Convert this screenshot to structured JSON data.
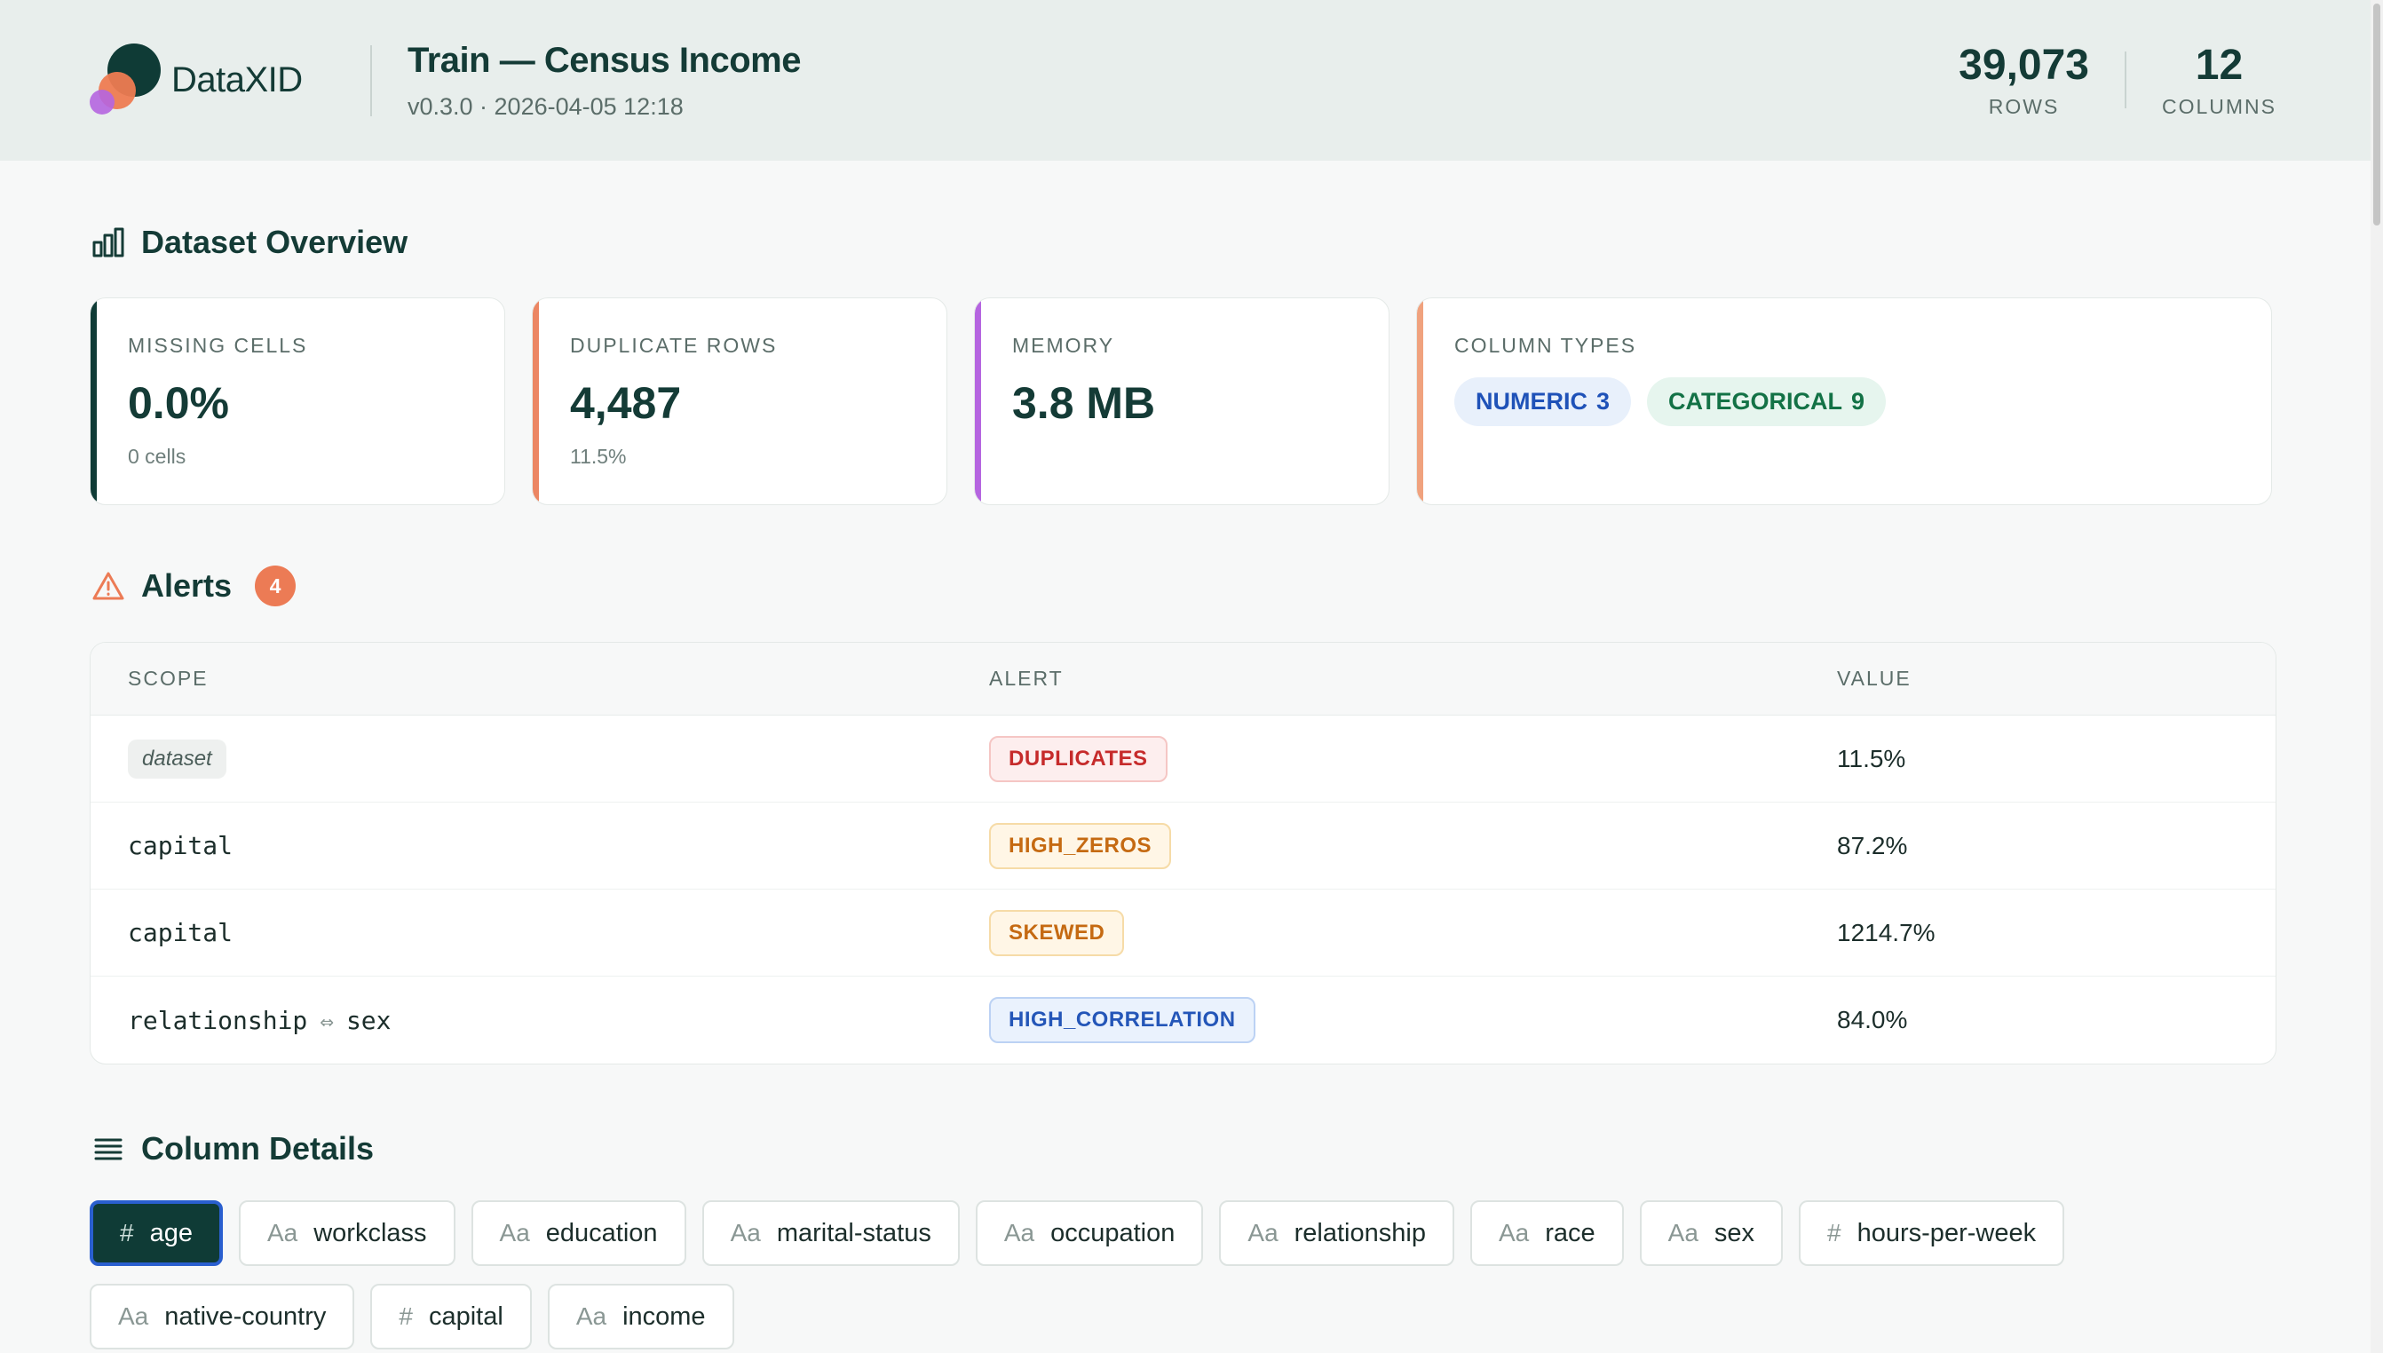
{
  "header": {
    "brand": "DataXID",
    "title": "Train — Census Income",
    "subtitle": "v0.3.0 · 2026-04-05 12:18",
    "stats": [
      {
        "value": "39,073",
        "label": "ROWS"
      },
      {
        "value": "12",
        "label": "COLUMNS"
      }
    ]
  },
  "overview": {
    "heading": "Dataset Overview",
    "cards": {
      "missing": {
        "label": "MISSING CELLS",
        "value": "0.0%",
        "sub": "0 cells",
        "accent": "#0f3b36"
      },
      "duplicates": {
        "label": "DUPLICATE ROWS",
        "value": "4,487",
        "sub": "11.5%",
        "accent": "#ec8663"
      },
      "memory": {
        "label": "MEMORY",
        "value": "3.8 MB",
        "accent": "#b565e0"
      },
      "types": {
        "label": "COLUMN TYPES",
        "accent": "#f0a27e",
        "numeric_label": "NUMERIC",
        "numeric_count": "3",
        "categorical_label": "CATEGORICAL",
        "categorical_count": "9"
      }
    }
  },
  "alerts": {
    "heading": "Alerts",
    "count": "4",
    "columns": [
      "SCOPE",
      "ALERT",
      "VALUE"
    ],
    "rows": [
      {
        "scope": "dataset",
        "alert": "DUPLICATES",
        "value": "11.5%",
        "color": "red"
      },
      {
        "scope": "capital",
        "alert": "HIGH_ZEROS",
        "value": "87.2%",
        "color": "amber"
      },
      {
        "scope": "capital",
        "alert": "SKEWED",
        "value": "1214.7%",
        "color": "amber"
      },
      {
        "scope_a": "relationship",
        "scope_b": "sex",
        "alert": "HIGH_CORRELATION",
        "value": "84.0%",
        "color": "blue"
      }
    ]
  },
  "column_details": {
    "heading": "Column Details",
    "columns": [
      {
        "type": "#",
        "name": "age"
      },
      {
        "type": "Aa",
        "name": "workclass"
      },
      {
        "type": "Aa",
        "name": "education"
      },
      {
        "type": "Aa",
        "name": "marital-status"
      },
      {
        "type": "Aa",
        "name": "occupation"
      },
      {
        "type": "Aa",
        "name": "relationship"
      },
      {
        "type": "Aa",
        "name": "race"
      },
      {
        "type": "Aa",
        "name": "sex"
      },
      {
        "type": "#",
        "name": "hours-per-week"
      },
      {
        "type": "Aa",
        "name": "native-country"
      },
      {
        "type": "#",
        "name": "capital"
      },
      {
        "type": "Aa",
        "name": "income"
      }
    ]
  }
}
